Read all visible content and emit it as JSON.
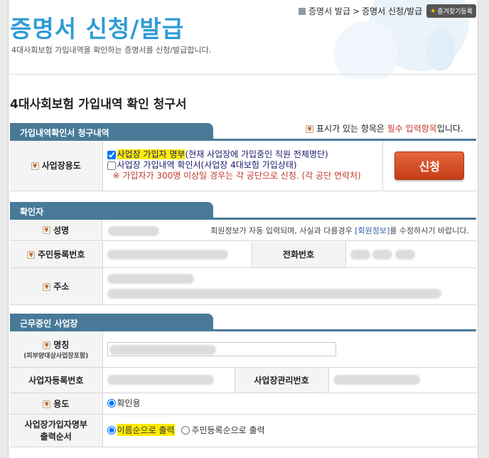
{
  "breadcrumb": {
    "items": [
      "증명서 발급",
      "증명서 신청/발급"
    ],
    "separator": ">",
    "favorite_label": "즐겨찾기등록"
  },
  "page": {
    "title": "증명서 신청/발급",
    "description": "4대사회보험 가입내역을 확인하는 증명서를 신청/발급합니다."
  },
  "form": {
    "title": "4대사회보험 가입내역 확인 청구서",
    "required_note_prefix": "표시가 있는 항목은 ",
    "required_note_highlight": "필수 입력항목",
    "required_note_suffix": "입니다."
  },
  "section1": {
    "header": "가입내역확인서 청구내역",
    "purpose_label": "사업장용도",
    "option1_highlight": "사업장 가입자 명부",
    "option1_rest": "(현재 사업장에 가입중인 직원 전체명단)",
    "option1_checked": true,
    "option2_text": "사업장 가입내역 확인서(사업장 4대보험 가입상태)",
    "option2_checked": false,
    "warning": "※ 가입자가 300명 이상일 경우는 각 공단으로 신청. (각 공단 연락처)",
    "apply_button": "신청"
  },
  "section2": {
    "header": "확인자",
    "name_label": "성명",
    "auto_note_prefix": "회원정보가 자동 입력되며, 사실과 다를경우 ",
    "auto_note_link": "[회원정보]",
    "auto_note_suffix": "를 수정하시기 바랍니다.",
    "rrn_label": "주민등록번호",
    "phone_label": "전화번호",
    "address_label": "주소"
  },
  "section3": {
    "header": "근무중인 사업장",
    "name_label": "명칭",
    "name_sublabel": "(피부양대상사업장포함)",
    "bizno_label": "사업자등록번호",
    "mgmtno_label": "사업장관리번호",
    "usage_label": "용도",
    "usage_option": "확인용",
    "order_label_line1": "사업장가입자명부",
    "order_label_line2": "출력순서",
    "order_option1": "이름순으로 출력",
    "order_option2": "주민등록순으로 출력"
  },
  "colors": {
    "title_blue": "#2f9bd6",
    "section_header": "#487a98",
    "apply_button": "#d14f26",
    "highlight_yellow": "#ffea00",
    "warning_red": "#c0392b"
  }
}
